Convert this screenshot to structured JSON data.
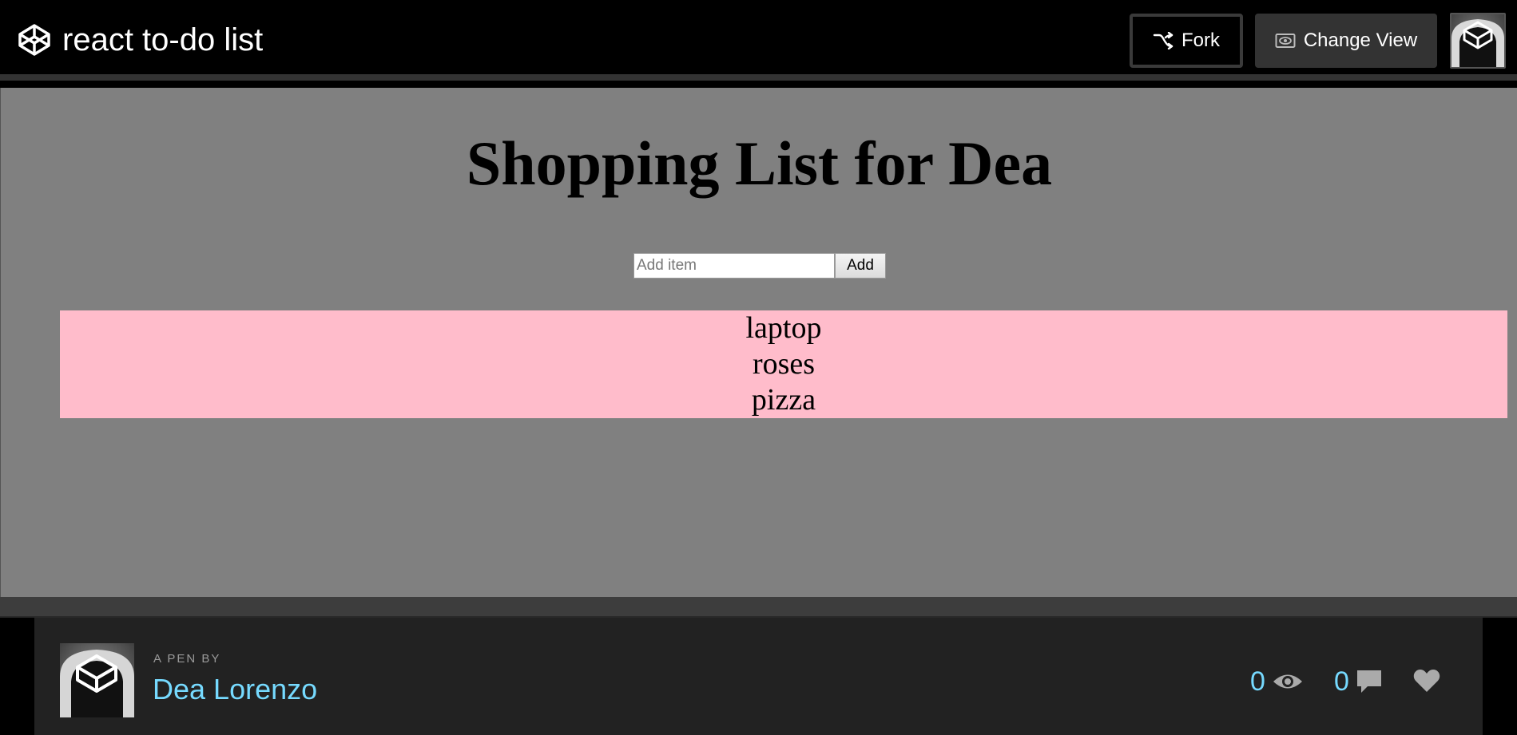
{
  "header": {
    "pen_title": "react to-do list",
    "fork_label": "Fork",
    "change_view_label": "Change View"
  },
  "app": {
    "title": "Shopping List for Dea",
    "input_placeholder": "Add item",
    "input_value": "",
    "add_label": "Add",
    "items": [
      "laptop",
      "roses",
      "pizza"
    ],
    "colors": {
      "background": "#808080",
      "list_background": "#ffbccb"
    }
  },
  "footer": {
    "pen_by_label": "A PEN BY",
    "author_name": "Dea Lorenzo",
    "views_count": "0",
    "comments_count": "0",
    "accent_color": "#76daff"
  },
  "icons": {
    "logo": "codepen-logo-icon",
    "fork": "fork-icon",
    "change_view": "eye-icon",
    "views": "eye-icon",
    "comments": "comment-icon",
    "like": "heart-icon"
  }
}
